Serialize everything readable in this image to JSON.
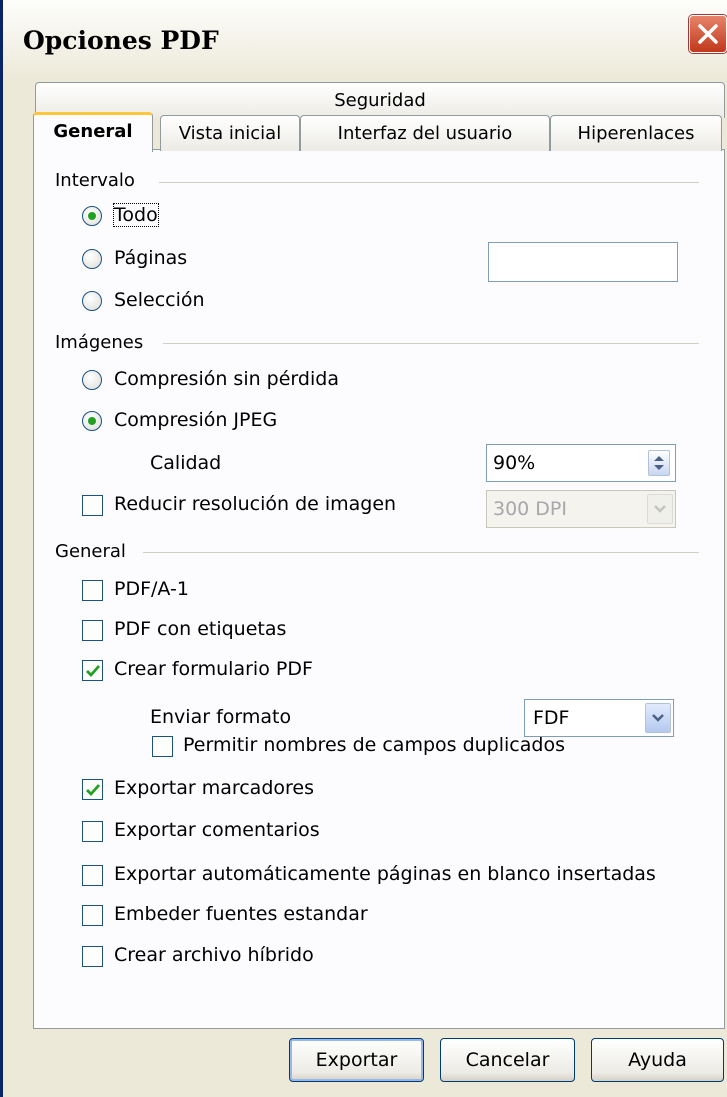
{
  "window": {
    "title": "Opciones PDF"
  },
  "tabs": {
    "row1": [
      "Seguridad"
    ],
    "row2": [
      "General",
      "Vista inicial",
      "Interfaz del usuario",
      "Hiperenlaces"
    ],
    "selected": "General"
  },
  "intervalo": {
    "heading": "Intervalo",
    "options": [
      {
        "label": "Todo",
        "checked": true
      },
      {
        "label": "Páginas",
        "checked": false
      },
      {
        "label": "Selección",
        "checked": false
      }
    ],
    "pages_value": ""
  },
  "imagenes": {
    "heading": "Imágenes",
    "options": [
      {
        "label": "Compresión sin pérdida",
        "checked": false
      },
      {
        "label": "Compresión JPEG",
        "checked": true
      }
    ],
    "quality_label": "Calidad",
    "quality_value": "90%",
    "reduce_label": "Reducir resolución de imagen",
    "reduce_checked": false,
    "resolution_value": "300 DPI"
  },
  "general": {
    "heading": "General",
    "pdfa": {
      "label": "PDF/A-1",
      "checked": false
    },
    "tagged": {
      "label": "PDF con etiquetas",
      "checked": false
    },
    "form": {
      "label": "Crear formulario PDF",
      "checked": true
    },
    "submit_label": "Enviar formato",
    "submit_value": "FDF",
    "dup_names": {
      "label": "Permitir nombres de campos duplicados",
      "checked": false
    },
    "bookmarks": {
      "label": "Exportar marcadores",
      "checked": true
    },
    "comments": {
      "label": "Exportar comentarios",
      "checked": false
    },
    "blank_pages": {
      "label": "Exportar automáticamente páginas en blanco insertadas",
      "checked": false
    },
    "std_fonts": {
      "label": "Embeder fuentes estandar",
      "checked": false
    },
    "hybrid": {
      "label": "Crear archivo híbrido",
      "checked": false
    }
  },
  "buttons": {
    "export": "Exportar",
    "cancel": "Cancelar",
    "help": "Ayuda"
  },
  "colors": {
    "accent_tab": "#ffc83c",
    "radio_dot": "#21a121",
    "close_button": "#c0391b"
  }
}
